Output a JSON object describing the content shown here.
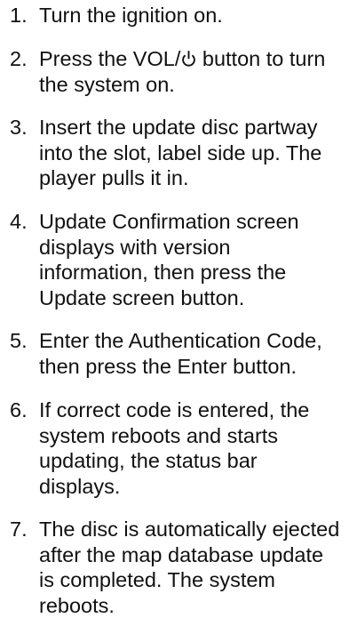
{
  "steps": [
    {
      "number": "1.",
      "lines": [
        "Turn the ignition on."
      ]
    },
    {
      "number": "2.",
      "lines_before_icon": "Press the VOL/",
      "lines_after_icon": " button to turn",
      "lines": [
        "the system on."
      ],
      "icon": "power-icon"
    },
    {
      "number": "3.",
      "lines": [
        "Insert the update disc partway",
        "into the slot, label side up. The",
        "player pulls it in."
      ]
    },
    {
      "number": "4.",
      "lines": [
        "Update Confirmation screen",
        "displays with version",
        "information, then press the",
        "Update screen button."
      ]
    },
    {
      "number": "5.",
      "lines": [
        "Enter the Authentication Code,",
        "then press the Enter button."
      ]
    },
    {
      "number": "6.",
      "lines": [
        "If correct code is entered, the",
        "system reboots and starts",
        "updating, the status bar",
        "displays."
      ]
    },
    {
      "number": "7.",
      "lines": [
        "The disc is automatically ejected",
        "after the map database update",
        "is completed. The system",
        "reboots."
      ]
    }
  ]
}
